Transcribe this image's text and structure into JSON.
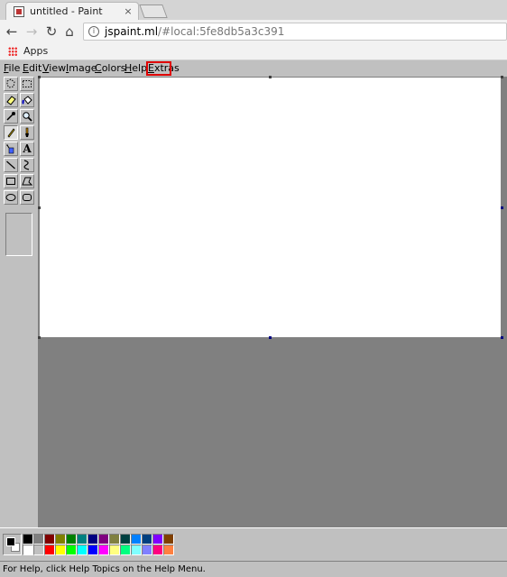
{
  "browser": {
    "tab": {
      "title": "untitled - Paint",
      "close_glyph": "×"
    },
    "nav": {
      "back_glyph": "←",
      "forward_glyph": "→",
      "reload_glyph": "↻",
      "home_glyph": "⌂"
    },
    "address": {
      "host": "jspaint.ml",
      "rest": "/#local:5fe8db5a3c391",
      "info_glyph": "i"
    },
    "bookmarks": {
      "apps_label": "Apps"
    }
  },
  "menus": [
    {
      "label": "File",
      "accel": "F",
      "rest": "ile"
    },
    {
      "label": "Edit",
      "accel": "E",
      "rest": "dit"
    },
    {
      "label": "View",
      "accel": "V",
      "rest": "iew"
    },
    {
      "label": "Image",
      "accel": "I",
      "rest": "mage"
    },
    {
      "label": "Colors",
      "accel": "C",
      "rest": "olors"
    },
    {
      "label": "Help",
      "accel": "H",
      "rest": "elp"
    },
    {
      "label": "Extras",
      "accel": "E",
      "rest": "xtras"
    }
  ],
  "tools": [
    {
      "name": "free-form-select",
      "icon": "free-form-select-icon"
    },
    {
      "name": "select",
      "icon": "rect-select-icon"
    },
    {
      "name": "eraser",
      "icon": "eraser-icon"
    },
    {
      "name": "fill-with-color",
      "icon": "fill-bucket-icon"
    },
    {
      "name": "pick-color",
      "icon": "eyedropper-icon"
    },
    {
      "name": "magnifier",
      "icon": "magnifier-icon"
    },
    {
      "name": "pencil",
      "icon": "pencil-icon",
      "selected": true
    },
    {
      "name": "brush",
      "icon": "brush-icon"
    },
    {
      "name": "airbrush",
      "icon": "airbrush-icon"
    },
    {
      "name": "text",
      "icon": "text-icon",
      "glyph": "A"
    },
    {
      "name": "line",
      "icon": "line-icon"
    },
    {
      "name": "curve",
      "icon": "curve-icon"
    },
    {
      "name": "rectangle",
      "icon": "rectangle-icon"
    },
    {
      "name": "polygon",
      "icon": "polygon-icon"
    },
    {
      "name": "ellipse",
      "icon": "ellipse-icon"
    },
    {
      "name": "rounded-rectangle",
      "icon": "rounded-rectangle-icon"
    }
  ],
  "colors": {
    "foreground": "#000000",
    "background": "#ffffff",
    "highlight_box": "#e00000",
    "palette_top": [
      "#000000",
      "#808080",
      "#800000",
      "#808000",
      "#008000",
      "#008080",
      "#000080",
      "#800080",
      "#808040",
      "#004040",
      "#0080ff",
      "#004080",
      "#8000ff",
      "#804000"
    ],
    "palette_bottom": [
      "#ffffff",
      "#c0c0c0",
      "#ff0000",
      "#ffff00",
      "#00ff00",
      "#00ffff",
      "#0000ff",
      "#ff00ff",
      "#ffff80",
      "#00ff80",
      "#80ffff",
      "#8080ff",
      "#ff0080",
      "#ff8040"
    ]
  },
  "status": {
    "text": "For Help, click Help Topics on the Help Menu."
  }
}
